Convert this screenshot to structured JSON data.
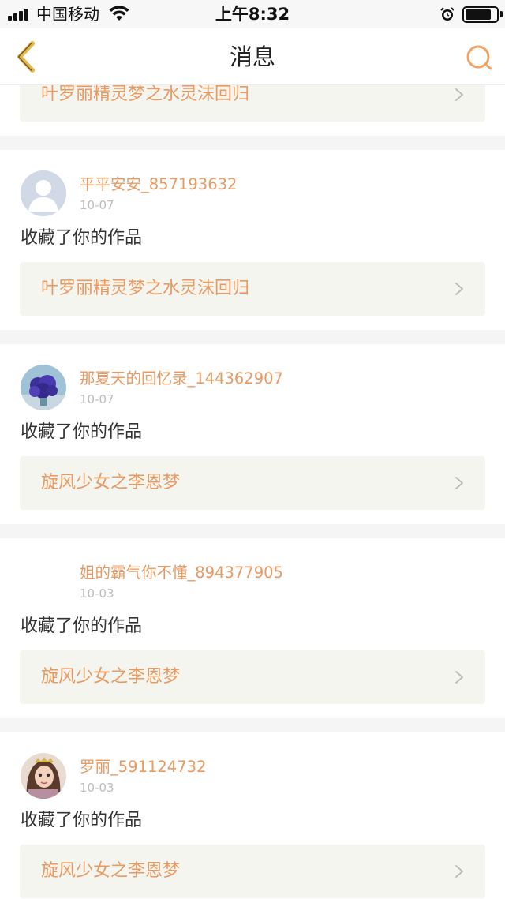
{
  "status_bar": {
    "carrier": "中国移动",
    "time": "上午8:32"
  },
  "nav": {
    "title": "消息",
    "back_icon": "chevron-left-icon",
    "search_icon": "search-icon"
  },
  "colors": {
    "accent": "#e89a62",
    "card_bg": "#f5f5ef",
    "separator": "#f5f5f5"
  },
  "partial_card": {
    "work_title": "叶罗丽精灵梦之水灵沫回归"
  },
  "messages": [
    {
      "username": "平平安安_857193632",
      "date": "10-07",
      "action": "收藏了你的作品",
      "work_title": "叶罗丽精灵梦之水灵沫回归",
      "avatar": "default-avatar-icon"
    },
    {
      "username": "那夏天的回忆录_144362907",
      "date": "10-07",
      "action": "收藏了你的作品",
      "work_title": "旋风少女之李恩梦",
      "avatar": "flower-avatar"
    },
    {
      "username": "姐的霸气你不懂_894377905",
      "date": "10-03",
      "action": "收藏了你的作品",
      "work_title": "旋风少女之李恩梦",
      "avatar": "blank-avatar"
    },
    {
      "username": "罗丽_591124732",
      "date": "10-03",
      "action": "收藏了你的作品",
      "work_title": "旋风少女之李恩梦",
      "avatar": "doll-avatar"
    }
  ]
}
